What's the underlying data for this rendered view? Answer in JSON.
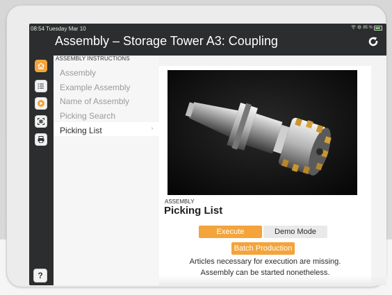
{
  "status": {
    "time": "08:54 Tuesday Mar 10",
    "battery": "85 %"
  },
  "header": {
    "title": "Assembly – Storage Tower A3: Coupling"
  },
  "rail": {
    "icons": [
      "home-icon",
      "list-icon",
      "play-icon",
      "scan-icon",
      "printer-icon"
    ],
    "help_label": "?",
    "bottom_icons": [
      "help-icon",
      "logout-icon"
    ]
  },
  "nav": {
    "heading": "ASSEMBLY INSTRUCTIONS",
    "items": [
      {
        "label": "Assembly"
      },
      {
        "label": "Example Assembly"
      },
      {
        "label": "Name of Assembly"
      },
      {
        "label": "Picking Search"
      },
      {
        "label": "Picking List"
      }
    ],
    "active_index": 4
  },
  "content": {
    "eyebrow": "ASSEMBLY",
    "heading": "Picking List",
    "buttons": {
      "execute": "Execute",
      "demo_mode": "Demo Mode",
      "batch_production": "Batch Production"
    },
    "message_line1": "Articles necessary for execution are missing.",
    "message_line2": "Assembly can be started nonetheless."
  },
  "colors": {
    "accent": "#f3a43a",
    "header_bg": "#2b2d2e",
    "battery_green": "#6ccf5a"
  }
}
